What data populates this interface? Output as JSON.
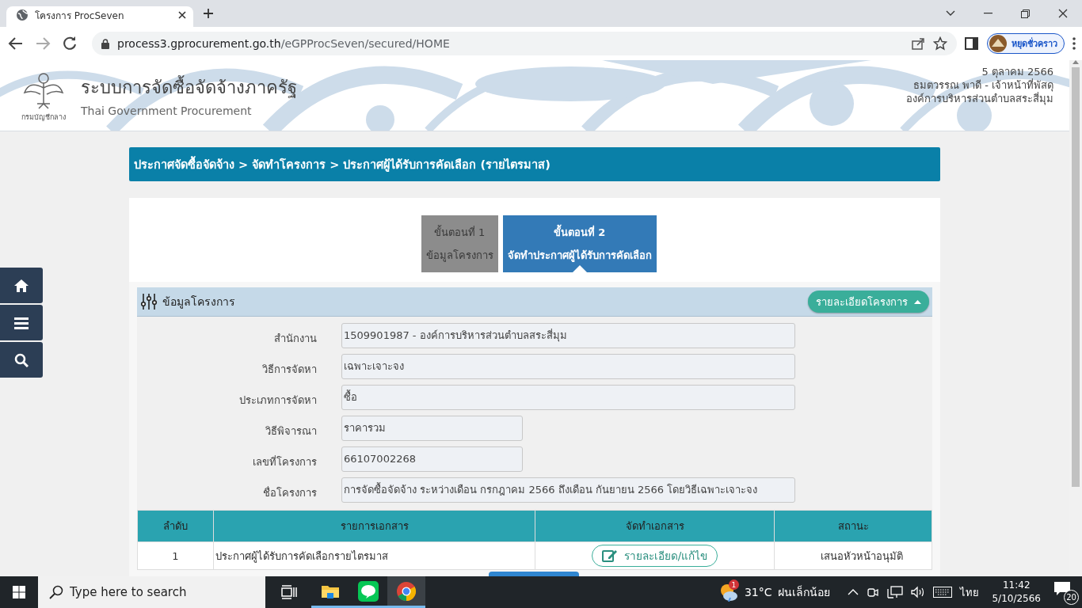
{
  "browser": {
    "tab_title": "โครงการ ProcSeven",
    "url_host": "process3.gprocurement.go.th",
    "url_path": "/eGPProcSeven/secured/HOME",
    "profile_label": "หยุดชั่วคราว"
  },
  "header": {
    "logo_caption": "กรมบัญชีกลาง",
    "title": "ระบบการจัดซื้อจัดจ้างภาครัฐ",
    "subtitle": "Thai Government Procurement",
    "date": "5 ตุลาคม 2566",
    "user": "ธมตวรรณ พาดี - เจ้าหน้าที่พัสดุ",
    "organization": "องค์การบริหารส่วนตำบลสระสี่มุม"
  },
  "breadcrumb": "ประกาศจัดซื้อจัดจ้าง > จัดทำโครงการ > ประกาศผู้ได้รับการคัดเลือก (รายไตรมาส)",
  "steps": [
    {
      "number": "ขั้นตอนที่ 1",
      "name": "ข้อมูลโครงการ",
      "selected": false
    },
    {
      "number": "ขั้นตอนที่ 2",
      "name": "จัดทำประกาศผู้ได้รับการคัดเลือก",
      "selected": true
    }
  ],
  "section": {
    "title": "ข้อมูลโครงการ",
    "toggle_button": "รายละเอียดโครงการ",
    "expanded": true
  },
  "fields": [
    {
      "label": "สำนักงาน",
      "value": "1509901987 - องค์การบริหารส่วนตำบลสระสี่มุม",
      "kind": "long"
    },
    {
      "label": "วิธีการจัดหา",
      "value": "เฉพาะเจาะจง",
      "kind": "long"
    },
    {
      "label": "ประเภทการจัดหา",
      "value": "ซื้อ",
      "kind": "long"
    },
    {
      "label": "วิธีพิจารณา",
      "value": "ราคารวม",
      "kind": "short"
    },
    {
      "label": "เลขที่โครงการ",
      "value": "66107002268",
      "kind": "short"
    },
    {
      "label": "ชื่อโครงการ",
      "value": "การจัดซื้อจัดจ้าง ระหว่างเดือน กรกฎาคม 2566 ถึงเดือน กันยายน 2566 โดยวิธีเฉพาะเจาะจง",
      "kind": "long"
    }
  ],
  "table": {
    "columns": [
      "ลำดับ",
      "รายการเอกสาร",
      "จัดทำเอกสาร",
      "สถานะ"
    ],
    "rows": [
      {
        "number": "1",
        "document": "ประกาศผู้ได้รับการคัดเลือกรายไตรมาส",
        "action": "รายละเอียด/แก้ไข",
        "status": "เสนอหัวหน้าอนุมัติ"
      }
    ]
  },
  "taskbar": {
    "search_placeholder": "Type here to search",
    "weather_badge": "1",
    "temperature": "31°C",
    "weather": "ฝนเล็กน้อย",
    "language": "ไทย",
    "time": "11:42",
    "date": "5/10/2566",
    "notifications": "20"
  }
}
